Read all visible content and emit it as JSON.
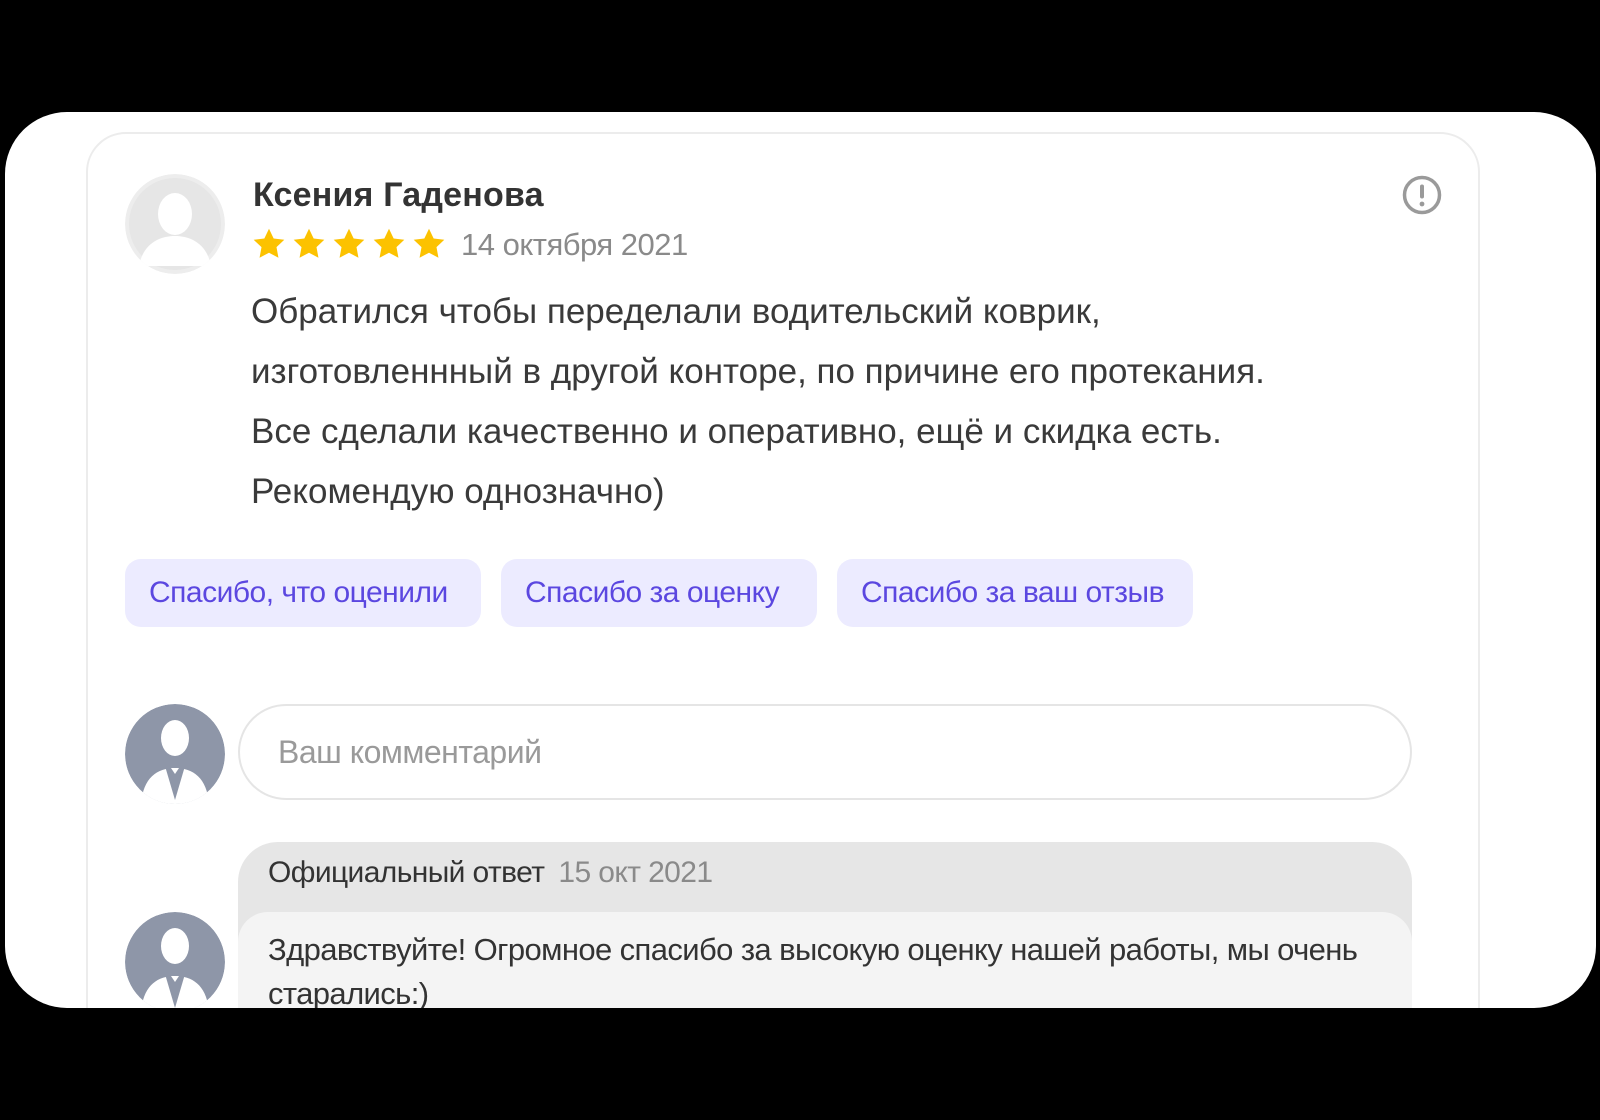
{
  "review": {
    "author_name": "Ксения Гаденова",
    "rating": 5,
    "rating_max": 5,
    "date": "14 октября 2021",
    "text_lines": [
      "Обратился чтобы переделали водительский коврик,",
      "изготовленнный в другой конторе, по причине его протекания.",
      "Все сделали качественно и оперативно, ещё и скидка есть.",
      "Рекомендую однозначно)"
    ]
  },
  "quick_replies": [
    "Спасибо, что оценили",
    "Спасибо за оценку",
    "Спасибо за ваш отзыв"
  ],
  "comment": {
    "placeholder": "Ваш комментарий",
    "value": ""
  },
  "official_reply": {
    "label": "Официальный ответ",
    "date": "15 окт 2021",
    "text": "Здравствуйте! Огромное спасибо за высокую оценку нашей работы, мы очень старались:)"
  },
  "icons": {
    "author_avatar": "default-user-avatar-icon",
    "report": "exclamation-circle-icon",
    "star": "star-icon",
    "user_avatar": "business-user-avatar-icon"
  },
  "colors": {
    "star": "#fcc200",
    "chip_bg": "#ecebff",
    "chip_text": "#5b47e0",
    "user_avatar": "#8e96a8"
  }
}
